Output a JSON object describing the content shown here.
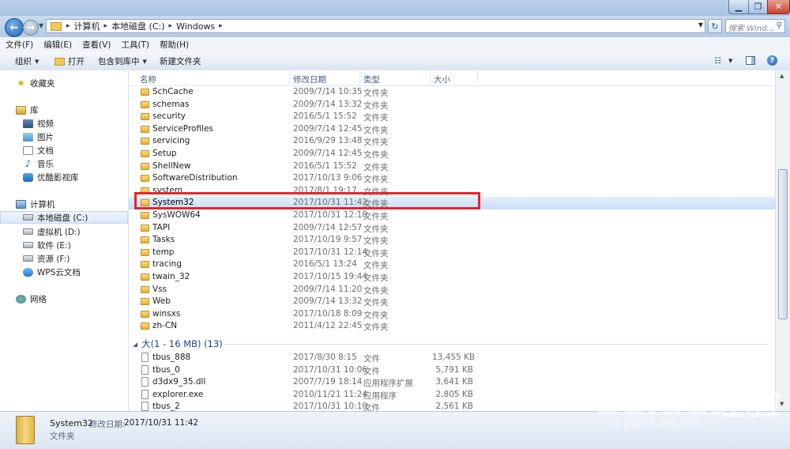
{
  "address": {
    "crumbs": [
      "计算机",
      "本地磁盘 (C:)",
      "Windows"
    ],
    "search_placeholder": "搜索 Wind..."
  },
  "menu": [
    "文件(F)",
    "编辑(E)",
    "查看(V)",
    "工具(T)",
    "帮助(H)"
  ],
  "commands": {
    "organize": "组织",
    "open": "打开",
    "include_library": "包含到库中",
    "new_folder": "新建文件夹"
  },
  "nav": {
    "favorites": "收藏夹",
    "libraries": "库",
    "library_items": [
      "视频",
      "图片",
      "文档",
      "音乐",
      "优酷影视库"
    ],
    "computer": "计算机",
    "drives": [
      "本地磁盘 (C:)",
      "虚拟机 (D:)",
      "软件 (E:)",
      "资源 (F:)",
      "WPS云文档"
    ],
    "network": "网络"
  },
  "columns": {
    "name": "名称",
    "date": "修改日期",
    "type": "类型",
    "size": "大小"
  },
  "folders": [
    {
      "name": "SchCache",
      "date": "2009/7/14 10:35",
      "type": "文件夹"
    },
    {
      "name": "schemas",
      "date": "2009/7/14 13:32",
      "type": "文件夹"
    },
    {
      "name": "security",
      "date": "2016/5/1 15:52",
      "type": "文件夹"
    },
    {
      "name": "ServiceProfiles",
      "date": "2009/7/14 12:45",
      "type": "文件夹"
    },
    {
      "name": "servicing",
      "date": "2016/9/29 13:48",
      "type": "文件夹"
    },
    {
      "name": "Setup",
      "date": "2009/7/14 12:45",
      "type": "文件夹"
    },
    {
      "name": "ShellNew",
      "date": "2016/5/1 15:52",
      "type": "文件夹"
    },
    {
      "name": "SoftwareDistribution",
      "date": "2017/10/13 9:06",
      "type": "文件夹"
    },
    {
      "name": "system",
      "date": "2017/8/1 19:17",
      "type": "文件夹"
    },
    {
      "name": "System32",
      "date": "2017/10/31 11:42",
      "type": "文件夹"
    },
    {
      "name": "SysWOW64",
      "date": "2017/10/31 12:10",
      "type": "文件夹"
    },
    {
      "name": "TAPI",
      "date": "2009/7/14 12:57",
      "type": "文件夹"
    },
    {
      "name": "Tasks",
      "date": "2017/10/19 9:57",
      "type": "文件夹"
    },
    {
      "name": "temp",
      "date": "2017/10/31 12:14",
      "type": "文件夹"
    },
    {
      "name": "tracing",
      "date": "2016/5/1 13:24",
      "type": "文件夹"
    },
    {
      "name": "twain_32",
      "date": "2017/10/15 19:44",
      "type": "文件夹"
    },
    {
      "name": "Vss",
      "date": "2009/7/14 11:20",
      "type": "文件夹"
    },
    {
      "name": "Web",
      "date": "2009/7/14 13:32",
      "type": "文件夹"
    },
    {
      "name": "winsxs",
      "date": "2017/10/18 8:09",
      "type": "文件夹"
    },
    {
      "name": "zh-CN",
      "date": "2011/4/12 22:45",
      "type": "文件夹"
    }
  ],
  "group_label": "大(1 - 16 MB) (13)",
  "files": [
    {
      "name": "tbus_888",
      "date": "2017/8/30 8:15",
      "type": "文件",
      "size": "13,455 KB"
    },
    {
      "name": "tbus_0",
      "date": "2017/10/31 10:06",
      "type": "文件",
      "size": "5,791 KB"
    },
    {
      "name": "d3dx9_35.dll",
      "date": "2007/7/19 18:14",
      "type": "应用程序扩展",
      "size": "3,641 KB"
    },
    {
      "name": "explorer.exe",
      "date": "2010/11/21 11:24",
      "type": "应用程序",
      "size": "2,805 KB"
    },
    {
      "name": "tbus_2",
      "date": "2017/10/31 10:10",
      "type": "文件",
      "size": "2,561 KB"
    }
  ],
  "details": {
    "name": "System32",
    "modified_label": "修改日期:",
    "modified_value": "2017/10/31 11:42",
    "type": "文件夹"
  },
  "watermark": {
    "brand": "Baidu经验",
    "url": "jingyan.baidu.com"
  },
  "colors": {
    "highlight": "#e8232d",
    "selection": "#c9def6",
    "group_text": "#1e3d8f"
  }
}
